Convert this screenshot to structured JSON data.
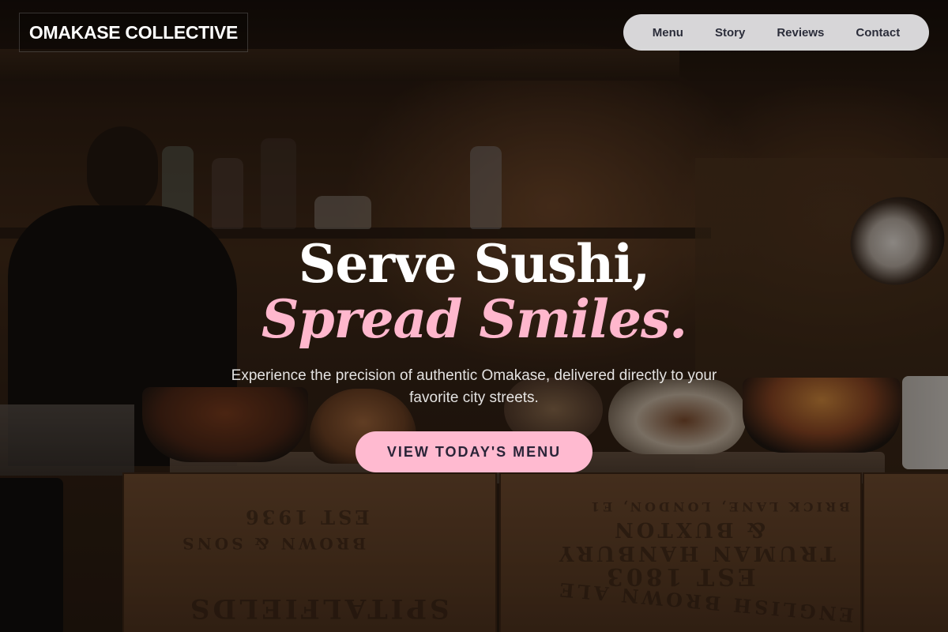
{
  "header": {
    "logo_text": "OMAKASE COLLECTIVE",
    "nav": [
      {
        "label": "Menu"
      },
      {
        "label": "Story"
      },
      {
        "label": "Reviews"
      },
      {
        "label": "Contact"
      }
    ]
  },
  "hero": {
    "headline_line1": "Serve Sushi,",
    "headline_line2": "Spread Smiles.",
    "subtext": "Experience the precision of authentic Omakase, delivered directly to your favorite city streets.",
    "cta_label": "VIEW TODAY'S MENU"
  },
  "background_text": {
    "crate1_line1": "EST 1936",
    "crate1_line2": "BROWN & SONS",
    "crate1_line3": "SPITALFIELDS",
    "crate2_line1": "BRICK LANE, LONDON, E1",
    "crate2_line2": "& BUXTON",
    "crate2_line3": "TRUMAN HANBURY",
    "crate2_line4": "EST 1803",
    "crate2_line5": "ENGLISH BROWN ALE"
  },
  "colors": {
    "accent_pink": "#ffb7cd",
    "cta_background": "#ffbad0",
    "nav_background": "#e8e8ea",
    "nav_text": "#2b2d3a"
  }
}
